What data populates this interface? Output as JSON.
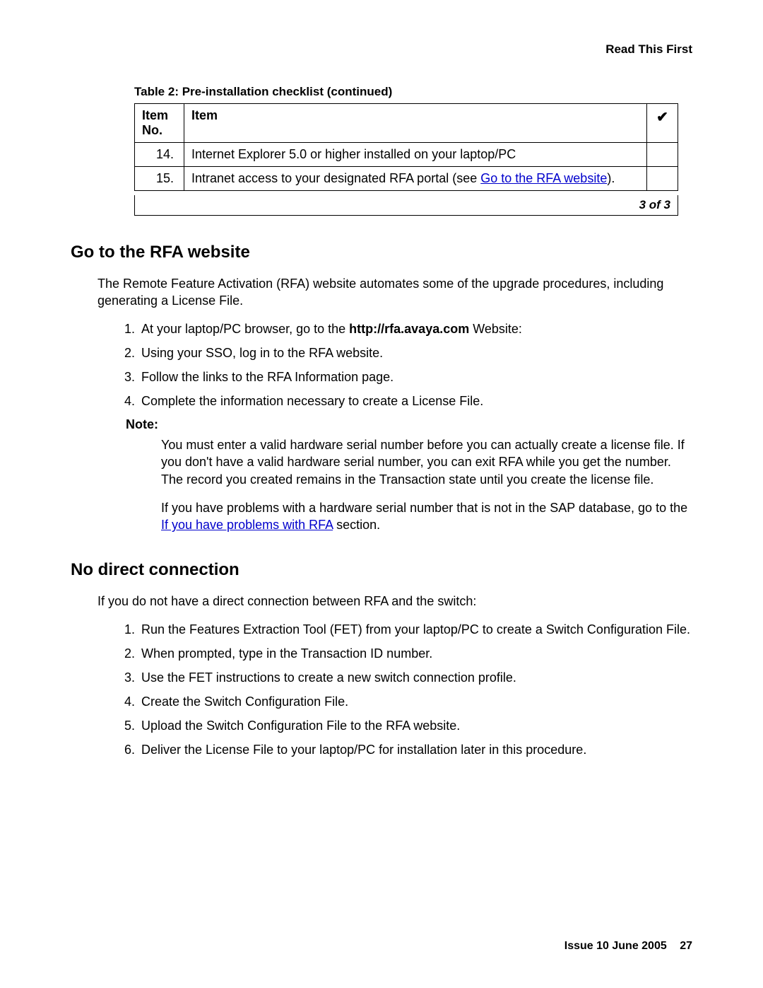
{
  "header": {
    "right": "Read This First"
  },
  "table": {
    "caption": "Table 2: Pre-installation checklist  (continued)",
    "col_no": "Item No.",
    "col_item": "Item",
    "col_check": "✔",
    "rows": [
      {
        "no": "14.",
        "text": "Internet Explorer 5.0 or higher installed on your laptop/PC"
      },
      {
        "no": "15.",
        "text_pre": "Intranet access to your designated RFA portal (see ",
        "link": "Go to the RFA website",
        "text_post": ")."
      }
    ],
    "page_of": "3 of 3"
  },
  "rfa": {
    "heading": "Go to the RFA website",
    "intro": "The Remote Feature Activation (RFA) website automates some of the upgrade procedures, including generating a License File.",
    "steps": {
      "s1_pre": "At your laptop/PC browser, go to the ",
      "s1_bold": "http://rfa.avaya.com",
      "s1_post": " Website:",
      "s2": "Using your SSO, log in to the RFA website.",
      "s3": "Follow the links to the RFA Information page.",
      "s4": "Complete the information necessary to create a License File."
    },
    "note_label": "Note:",
    "note1": "You must enter a valid hardware serial number before you can actually create a license file. If you don't have a valid hardware serial number, you can exit RFA while you get the number. The record you created remains in the Transaction state until you create the license file.",
    "note2_pre": "If you have problems with a hardware serial number that is not in the SAP database, go to the ",
    "note2_link": "If you have problems with RFA",
    "note2_post": " section."
  },
  "nodirect": {
    "heading": "No direct connection",
    "intro": "If you do not have a direct connection between RFA and the switch:",
    "steps": {
      "s1": "Run the Features Extraction Tool (FET) from your laptop/PC to create a Switch Configuration File.",
      "s2": "When prompted, type in the Transaction ID number.",
      "s3": "Use the FET instructions to create a new switch connection profile.",
      "s4": "Create the Switch Configuration File.",
      "s5": "Upload the Switch Configuration File to the RFA website.",
      "s6": "Deliver the License File to your laptop/PC for installation later in this procedure."
    }
  },
  "footer": {
    "issue": "Issue 10    June 2005",
    "page": "27"
  }
}
